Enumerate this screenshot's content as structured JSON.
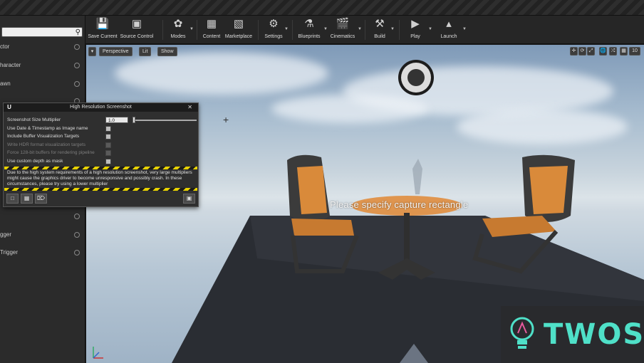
{
  "toolbar": {
    "buttons": [
      {
        "label": "Save Current"
      },
      {
        "label": "Source Control"
      },
      {
        "label": "Modes"
      },
      {
        "label": "Content"
      },
      {
        "label": "Marketplace"
      },
      {
        "label": "Settings"
      },
      {
        "label": "Blueprints"
      },
      {
        "label": "Cinematics"
      },
      {
        "label": "Build"
      },
      {
        "label": "Play"
      },
      {
        "label": "Launch"
      }
    ]
  },
  "left_panel": {
    "search_icon": "search-icon",
    "items": [
      {
        "label": "ctor"
      },
      {
        "label": "haracter"
      },
      {
        "label": "awn"
      },
      {
        "label": "gger"
      },
      {
        "label": "Trigger"
      }
    ]
  },
  "viewport": {
    "view_mode": "Perspective",
    "lit_mode": "Lit",
    "show_label": "Show",
    "grid_snap_value": "10",
    "capture_message": "Please specify capture rectangle"
  },
  "dialog": {
    "title": "High Resolution Screenshot",
    "close_glyph": "✕",
    "multiplier_label": "Screenshot Size Multiplier",
    "multiplier_value": "1.0",
    "options": [
      {
        "label": "Use Date & Timestamp as Image name",
        "enabled": true
      },
      {
        "label": "Include Buffer Visualization Targets",
        "enabled": true
      },
      {
        "label": "Write HDR format visualization targets",
        "enabled": false
      },
      {
        "label": "Force 128-bit buffers for rendering pipeline",
        "enabled": false
      },
      {
        "label": "Use custom depth as mask",
        "enabled": true
      }
    ],
    "warning": "Due to the high system requirements of a high resolution screenshot, very large multipliers might cause the graphics driver to become unresponsive and possibly crash. In these circumstances, please try using a lower multiplier"
  },
  "watermark": {
    "text": "TWOS"
  },
  "colors": {
    "accent_watermark": "#4fe0c8",
    "hazard_yellow": "#e8d200",
    "panel_bg": "#2b2b2b"
  }
}
